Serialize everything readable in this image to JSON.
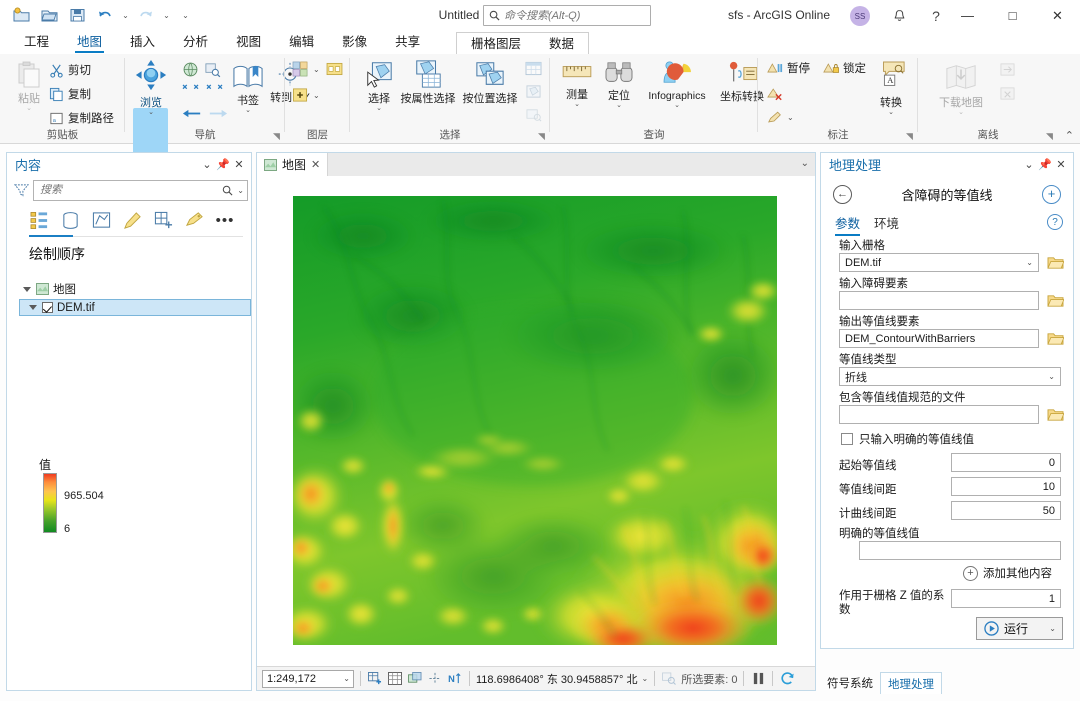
{
  "titlebar": {
    "doc_title": "Untitled",
    "search_placeholder": "命令搜索(Alt-Q)",
    "account": "sfs - ArcGIS Online",
    "avatar_initials": "SS",
    "qat": [
      {
        "name": "new-project-icon",
        "label": "新建"
      },
      {
        "name": "open-project-icon",
        "label": "打开"
      },
      {
        "name": "save-project-icon",
        "label": "保存"
      },
      {
        "name": "undo-icon",
        "label": "撤销"
      },
      {
        "name": "redo-icon",
        "label": "重做"
      },
      {
        "name": "customize-qat-icon",
        "label": "自定义快速访问工具栏"
      }
    ],
    "notification_label": "通知",
    "help_label": "?",
    "minimize_label": "—",
    "maximize_label": "□",
    "close_label": "✕"
  },
  "ribbon": {
    "tabs": [
      {
        "label": "工程",
        "active": false
      },
      {
        "label": "地图",
        "active": true
      },
      {
        "label": "插入",
        "active": false
      },
      {
        "label": "分析",
        "active": false
      },
      {
        "label": "视图",
        "active": false
      },
      {
        "label": "编辑",
        "active": false
      },
      {
        "label": "影像",
        "active": false
      },
      {
        "label": "共享",
        "active": false
      }
    ],
    "contextual_tabs": [
      {
        "label": "栅格图层",
        "selected": true
      },
      {
        "label": "数据",
        "selected": false
      }
    ],
    "groups": [
      {
        "name": "clipboard",
        "label": "剪贴板",
        "big_buttons": [
          {
            "label": "粘贴",
            "caret": "⌄",
            "icon": "paste-icon"
          }
        ],
        "small_buttons": [
          {
            "label": "剪切",
            "icon": "cut-icon"
          },
          {
            "label": "复制",
            "icon": "copy-icon"
          },
          {
            "label": "复制路径",
            "icon": "copy-path-icon"
          }
        ]
      },
      {
        "name": "navigate",
        "label": "导航",
        "big_buttons": [
          {
            "label": "浏览",
            "caret": "⌄",
            "icon": "explore-icon"
          },
          {
            "label": "书签",
            "caret": "⌄",
            "icon": "bookmarks-icon"
          },
          {
            "label": "转到 XY",
            "caret": "",
            "icon": "go-to-xy-icon"
          }
        ]
      },
      {
        "name": "layer",
        "label": "图层",
        "big_buttons": []
      },
      {
        "name": "selection",
        "label": "选择",
        "big_buttons": [
          {
            "label": "选择",
            "caret": "⌄",
            "icon": "select-by-rectangle-icon"
          },
          {
            "label": "按属性选择",
            "caret": "",
            "icon": "select-by-attributes-icon"
          },
          {
            "label": "按位置选择",
            "caret": "",
            "icon": "select-by-location-icon"
          }
        ]
      },
      {
        "name": "inquiry",
        "label": "查询",
        "big_buttons": [
          {
            "label": "测量",
            "caret": "⌄",
            "icon": "measure-icon"
          },
          {
            "label": "定位",
            "caret": "⌄",
            "icon": "locate-icon"
          },
          {
            "label": "Infographics",
            "caret": "⌄",
            "icon": "infographics-icon"
          },
          {
            "label": "坐标转换",
            "caret": "",
            "icon": "convert-coordinates-icon"
          }
        ]
      },
      {
        "name": "labeling",
        "label": "标注",
        "small_buttons": [
          {
            "label": "暂停",
            "icon": "pause-labeling-icon"
          },
          {
            "label": "锁定",
            "icon": "lock-labeling-icon"
          },
          {
            "label": "",
            "icon": "remove-label-icon"
          },
          {
            "label": "",
            "icon": "label-style-icon"
          }
        ],
        "big_buttons": [
          {
            "label": "转换",
            "caret": "⌄",
            "icon": "convert-labels-icon"
          }
        ]
      },
      {
        "name": "offline",
        "label": "离线",
        "big_buttons": [
          {
            "label": "下载地图",
            "caret": "⌄",
            "icon": "download-map-icon"
          }
        ]
      }
    ]
  },
  "contents": {
    "title": "内容",
    "search_placeholder": "搜索",
    "tabs": [
      {
        "name": "list-by-drawing-order-icon",
        "active": true
      },
      {
        "name": "list-by-data-source-icon",
        "active": false
      },
      {
        "name": "list-by-selection-icon",
        "active": false
      },
      {
        "name": "list-by-editing-icon",
        "active": false
      },
      {
        "name": "list-by-snapping-icon",
        "active": false
      },
      {
        "name": "list-by-labeling-icon",
        "active": false
      },
      {
        "name": "more-options-icon",
        "active": false
      }
    ],
    "toc_title": "绘制顺序",
    "map_node": "地图",
    "layer_node": "DEM.tif",
    "layer_checked": true,
    "legend_label": "值",
    "legend_max": "965.504",
    "legend_min": "6"
  },
  "mapview": {
    "tab_label": "地图",
    "tab_close": "✕",
    "status": {
      "scale": "1:249,172",
      "coordinates": "118.6986408° 东  30.9458857° 北",
      "selected_features": "所选要素: 0",
      "icons": [
        {
          "name": "add-data-icon"
        },
        {
          "name": "open-table-icon"
        },
        {
          "name": "basemap-icon"
        },
        {
          "name": "snapping-icon"
        },
        {
          "name": "north-indicator-icon"
        },
        {
          "name": "find-selection-icon"
        },
        {
          "name": "pause-drawing-icon"
        },
        {
          "name": "refresh-icon"
        }
      ]
    }
  },
  "geoprocessing": {
    "title": "地理处理",
    "tool_name": "含障碍的等值线",
    "back_label": "←",
    "add_label": "+",
    "tabs": [
      {
        "label": "参数",
        "active": true
      },
      {
        "label": "环境",
        "active": false
      }
    ],
    "help_label": "?",
    "fields": [
      {
        "label": "输入栅格",
        "value": "DEM.tif",
        "type": "combo",
        "browse": true
      },
      {
        "label": "输入障碍要素",
        "value": "",
        "type": "text",
        "browse": true
      },
      {
        "label": "输出等值线要素",
        "value": "DEM_ContourWithBarriers",
        "type": "text",
        "browse": true
      },
      {
        "label": "等值线类型",
        "value": "折线",
        "type": "combo",
        "browse": false
      },
      {
        "label": "包含等值线值规范的文件",
        "value": "",
        "type": "text",
        "browse": true
      }
    ],
    "checkbox_label": "只输入明确的等值线值",
    "checkbox_checked": false,
    "numeric_fields": [
      {
        "label": "起始等值线",
        "value": "0"
      },
      {
        "label": "等值线间距",
        "value": "10"
      },
      {
        "label": "计曲线间距",
        "value": "50"
      }
    ],
    "explicit_label": "明确的等值线值",
    "explicit_value": "",
    "add_other_label": "添加其他内容",
    "zfactor_label": "作用于栅格 Z 值的系数",
    "zfactor_value": "1",
    "run_label": "运行",
    "run_caret": "⌄"
  },
  "bottom_tabs": [
    {
      "label": "符号系统",
      "active": false
    },
    {
      "label": "地理处理",
      "active": true
    }
  ],
  "colors": {
    "accent": "#0a7cc4",
    "pane_border": "#c2d9e8",
    "ribbon_bg": "#f7f7f7",
    "selection": "#cde6f7",
    "ramp_high": "#f03b20",
    "ramp_low": "#118a22"
  }
}
